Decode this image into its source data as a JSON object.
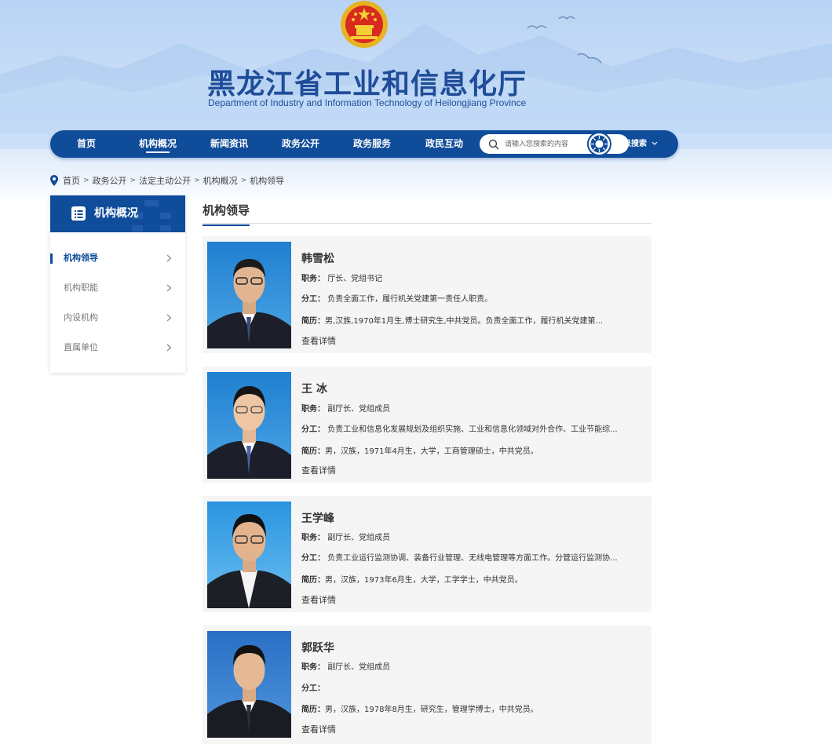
{
  "site": {
    "title_cn": "黑龙江省工业和信息化厅",
    "title_en": "Department of Industry and Information Technology of Heilongjiang Province"
  },
  "nav": {
    "items": [
      {
        "label": "首页"
      },
      {
        "label": "机构概况",
        "active": true
      },
      {
        "label": "新闻资讯"
      },
      {
        "label": "政务公开"
      },
      {
        "label": "政务服务"
      },
      {
        "label": "政民互动"
      }
    ],
    "search_placeholder": "请输入您搜索的内容",
    "advanced_search": "高级搜索"
  },
  "breadcrumb": [
    "首页",
    "政务公开",
    "法定主动公开",
    "机构概况",
    "机构领导"
  ],
  "sidebar": {
    "title": "机构概况",
    "items": [
      {
        "label": "机构领导",
        "active": true
      },
      {
        "label": "机构职能"
      },
      {
        "label": "内设机构"
      },
      {
        "label": "直属单位"
      }
    ]
  },
  "section_title": "机构领导",
  "labels": {
    "position": "职务：",
    "duty": "分工：",
    "resume": "简历：",
    "details": "查看详情"
  },
  "leaders": [
    {
      "name": "韩雪松",
      "position": "厅长、党组书记",
      "duty": "负责全面工作，履行机关党建第一责任人职责。",
      "resume": "男,汉族,1970年1月生,博士研究生,中共党员。负责全面工作，履行机关党建第..."
    },
    {
      "name": "王  冰",
      "position": "副厅长、党组成员",
      "duty": "负责工业和信息化发展规划及组织实施、工业和信息化领域对外合作、工业节能综...",
      "resume": "男，汉族，1971年4月生，大学，工商管理硕士，中共党员。"
    },
    {
      "name": "王学峰",
      "position": "副厅长、党组成员",
      "duty": "负责工业运行监测协调、装备行业管理、无线电管理等方面工作。分管运行监测协...",
      "resume": "男，汉族，1973年6月生，大学，工学学士，中共党员。"
    },
    {
      "name": "郭跃华",
      "position": "副厅长、党组成员",
      "duty": "",
      "resume": "男，汉族，1978年8月生，研究生，管理学博士，中共党员。"
    }
  ],
  "colors": {
    "brand_blue": "#0f4c99",
    "header_bg": "#cfe1f8",
    "card_bg": "#f5f5f5"
  }
}
